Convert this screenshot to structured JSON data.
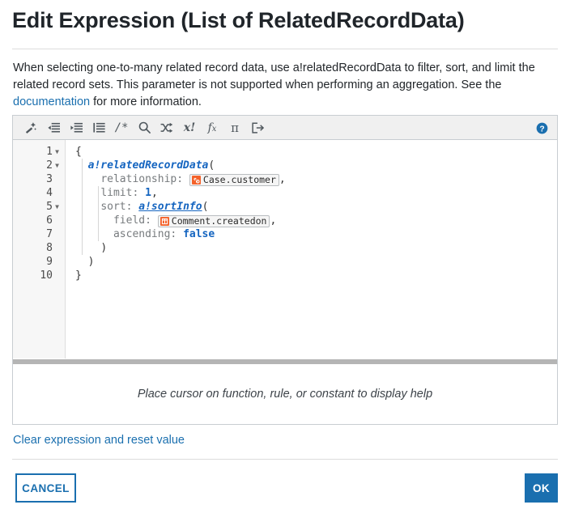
{
  "dialog": {
    "title": "Edit Expression (List of RelatedRecordData)",
    "description_before": "When selecting one-to-many related record data, use a!relatedRecordData to filter, sort, and limit the related record sets. This parameter is not supported when performing an aggregation. See the ",
    "description_link": "documentation",
    "description_after": " for more information."
  },
  "toolbar": {
    "items": [
      {
        "name": "format-wand-icon",
        "title": "Format expression"
      },
      {
        "name": "outdent-icon",
        "title": "Outdent"
      },
      {
        "name": "indent-icon",
        "title": "Indent"
      },
      {
        "name": "indent-lines-icon",
        "title": "Indent lines"
      },
      {
        "name": "comment-icon",
        "title": "Comment",
        "label": "/*"
      },
      {
        "name": "search-icon",
        "title": "Find"
      },
      {
        "name": "shuffle-icon",
        "title": "Replace"
      },
      {
        "name": "clear-variable-icon",
        "title": "Clear",
        "label": "x!"
      },
      {
        "name": "function-icon",
        "title": "Functions",
        "label": "fx"
      },
      {
        "name": "rule-icon",
        "title": "Rules",
        "label": "π"
      },
      {
        "name": "export-icon",
        "title": "Export"
      }
    ],
    "help_icon": "help-circle-icon"
  },
  "editor": {
    "lines": [
      {
        "number": "1",
        "fold": true
      },
      {
        "number": "2",
        "fold": true
      },
      {
        "number": "3",
        "fold": false
      },
      {
        "number": "4",
        "fold": false
      },
      {
        "number": "5",
        "fold": true
      },
      {
        "number": "6",
        "fold": false
      },
      {
        "number": "7",
        "fold": false
      },
      {
        "number": "8",
        "fold": false
      },
      {
        "number": "9",
        "fold": false
      },
      {
        "number": "10",
        "fold": false
      }
    ],
    "code": {
      "l1_brace": "{",
      "l2_fn": "a!relatedRecordData",
      "l2_paren": "(",
      "l3_param": "relationship:",
      "l3_chip": "Case.customer",
      "l3_chip_icon": "relationship-icon",
      "l3_comma": ",",
      "l4_param": "limit:",
      "l4_value": "1",
      "l4_comma": ",",
      "l5_param": "sort:",
      "l5_fn": "a!sortInfo",
      "l5_paren": "(",
      "l6_param": "field:",
      "l6_chip": "Comment.createdon",
      "l6_chip_icon": "record-field-icon",
      "l6_comma": ",",
      "l7_param": "ascending:",
      "l7_value": "false",
      "l8_paren": ")",
      "l9_paren": ")",
      "l10_brace": "}"
    }
  },
  "help_pane": {
    "placeholder": "Place cursor on function, rule, or constant to display help"
  },
  "footer": {
    "clear_link": "Clear expression and reset value",
    "cancel_label": "CANCEL",
    "ok_label": "OK"
  },
  "colors": {
    "accent_blue": "#1a6faf",
    "code_keyword": "#1565c0",
    "code_param": "#777b7e",
    "chip_icon_orange": "#f4622a",
    "toolbar_bg": "#f0f0f0",
    "splitter": "#b5b5b5"
  }
}
